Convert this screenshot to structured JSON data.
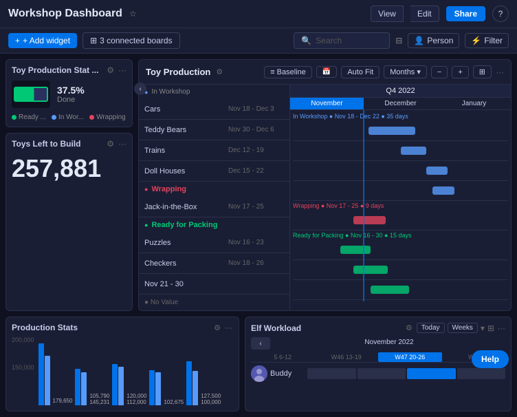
{
  "header": {
    "title": "Workshop Dashboard",
    "star_icon": "★",
    "view_label": "View",
    "edit_label": "Edit",
    "share_label": "Share",
    "help_icon": "?"
  },
  "toolbar": {
    "add_widget_label": "+ Add widget",
    "connected_boards_label": "3 connected boards",
    "search_placeholder": "Search",
    "filter_label": "Filter",
    "person_label": "Person",
    "board_icon": "⊞"
  },
  "toy_production_stat": {
    "title": "Toy Production Stat ...",
    "percent": "37.5%",
    "done_label": "Done",
    "legend": [
      {
        "label": "Ready ...",
        "color": "#00c875"
      },
      {
        "label": "In Wor...",
        "color": "#579bfc"
      },
      {
        "label": "Wrapping",
        "color": "#e2445c"
      }
    ]
  },
  "toys_left_to_build": {
    "title": "Toys Left to Build",
    "value": "257,881"
  },
  "toy_production_gantt": {
    "title": "Toy Production",
    "baseline_label": "Baseline",
    "auto_fit_label": "Auto Fit",
    "months_label": "Months",
    "quarter_label": "Q4 2022",
    "months": [
      "November",
      "December",
      "January"
    ],
    "groups": [
      {
        "name": "In Workshop",
        "color": "#579bfc",
        "tasks": [
          {
            "name": "Cars",
            "dates": "Nov 18 - Dec 3"
          },
          {
            "name": "Teddy Bears",
            "dates": "Nov 30 - Dec 6"
          },
          {
            "name": "Trains",
            "dates": "Dec 12 - 19"
          },
          {
            "name": "Doll Houses",
            "dates": "Dec 15 - 22"
          }
        ]
      },
      {
        "name": "Wrapping",
        "color": "#e2445c",
        "tasks": [
          {
            "name": "Jack-in-the-Box",
            "dates": "Nov 17 - 25"
          }
        ]
      },
      {
        "name": "Ready for Packing",
        "color": "#00c875",
        "tasks": [
          {
            "name": "Puzzles",
            "dates": "Nov 16 - 23"
          },
          {
            "name": "Checkers",
            "dates": "Nov 18 - 26"
          },
          {
            "name": "Nov 21 - 30",
            "dates": ""
          }
        ]
      }
    ],
    "no_value_label": "● No Value"
  },
  "production_stats": {
    "title": "Production Stats",
    "y_axis": [
      "200,000",
      "150,000"
    ],
    "bars": [
      {
        "values": [
          179650,
          145231
        ],
        "label": "179,650"
      },
      {
        "values": [
          105790,
          95000
        ],
        "label": "105,790"
      },
      {
        "values": [
          120000,
          112000
        ],
        "label": "120,000"
      },
      {
        "values": [
          102675,
          95000
        ],
        "label": "102,675"
      },
      {
        "values": [
          127500,
          100000
        ],
        "label": "127,500"
      }
    ]
  },
  "elf_workload": {
    "title": "Elf Workload",
    "today_label": "Today",
    "weeks_label": "Weeks",
    "month": "November 2022",
    "weeks": [
      "5  6-12",
      "W46  13-19",
      "W47  20-26",
      "W..."
    ],
    "elves": [
      {
        "name": "Buddy",
        "avatar": "B",
        "cells": [
          0,
          0,
          1,
          0
        ]
      }
    ]
  },
  "help": {
    "label": "Help"
  }
}
